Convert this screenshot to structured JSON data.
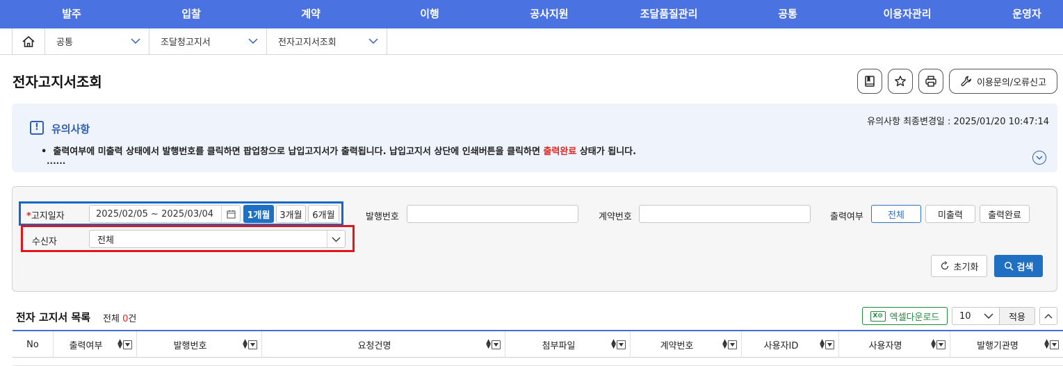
{
  "nav": {
    "items": [
      "발주",
      "입찰",
      "계약",
      "이행",
      "공사지원",
      "조달품질관리",
      "공통",
      "이용자관리",
      "운영자"
    ]
  },
  "breadcrumb": {
    "items": [
      "공통",
      "조달청고지서",
      "전자고지서조회"
    ]
  },
  "page": {
    "title": "전자고지서조회",
    "report_label": "이용문의/오류신고"
  },
  "notice": {
    "title": "유의사항",
    "updated": "유의사항 최종변경일 : 2025/01/20 10:47:14",
    "text_before": "출력여부에 미출력 상태에서 발행번호를 클릭하면 팝업창으로 납입고지서가 출력됩니다.  납입고지서 상단에 인쇄버튼을 클릭하면 ",
    "text_red": "출력완료",
    "text_after": " 상태가 됩니다.",
    "more": "......"
  },
  "search": {
    "date_label": "고지일자",
    "date_required_mark": "*",
    "date_range": "2025/02/05  ~  2025/03/04",
    "periods": [
      {
        "label": "1개월",
        "active": true
      },
      {
        "label": "3개월",
        "active": false
      },
      {
        "label": "6개월",
        "active": false
      }
    ],
    "recipient_label": "수신자",
    "recipient_value": "전체",
    "issue_no_label": "발행번호",
    "issue_no_value": "",
    "contract_no_label": "계약번호",
    "contract_no_value": "",
    "print_status_label": "출력여부",
    "print_status_options": [
      {
        "label": "전체",
        "active": true
      },
      {
        "label": "미출력",
        "active": false
      },
      {
        "label": "출력완료",
        "active": false
      }
    ],
    "reset_label": "초기화",
    "search_label": "검색"
  },
  "list": {
    "title": "전자 고지서 목록",
    "count_prefix": "전체 ",
    "count": "0",
    "count_suffix": "건",
    "excel_label": "엑셀다운로드",
    "page_size": "10",
    "apply_label": "적용",
    "columns": [
      "No",
      "출력여부",
      "발행번호",
      "요청건명",
      "첨부파일",
      "계약번호",
      "사용자ID",
      "사용자명",
      "발행기관명"
    ]
  },
  "colors": {
    "nav_bg": "#4a72e0",
    "primary": "#1f6fc3",
    "highlight_blue": "#1367c6",
    "highlight_red": "#e3141b",
    "accent_red": "#e0261f",
    "excel_green": "#1e8a3c"
  }
}
